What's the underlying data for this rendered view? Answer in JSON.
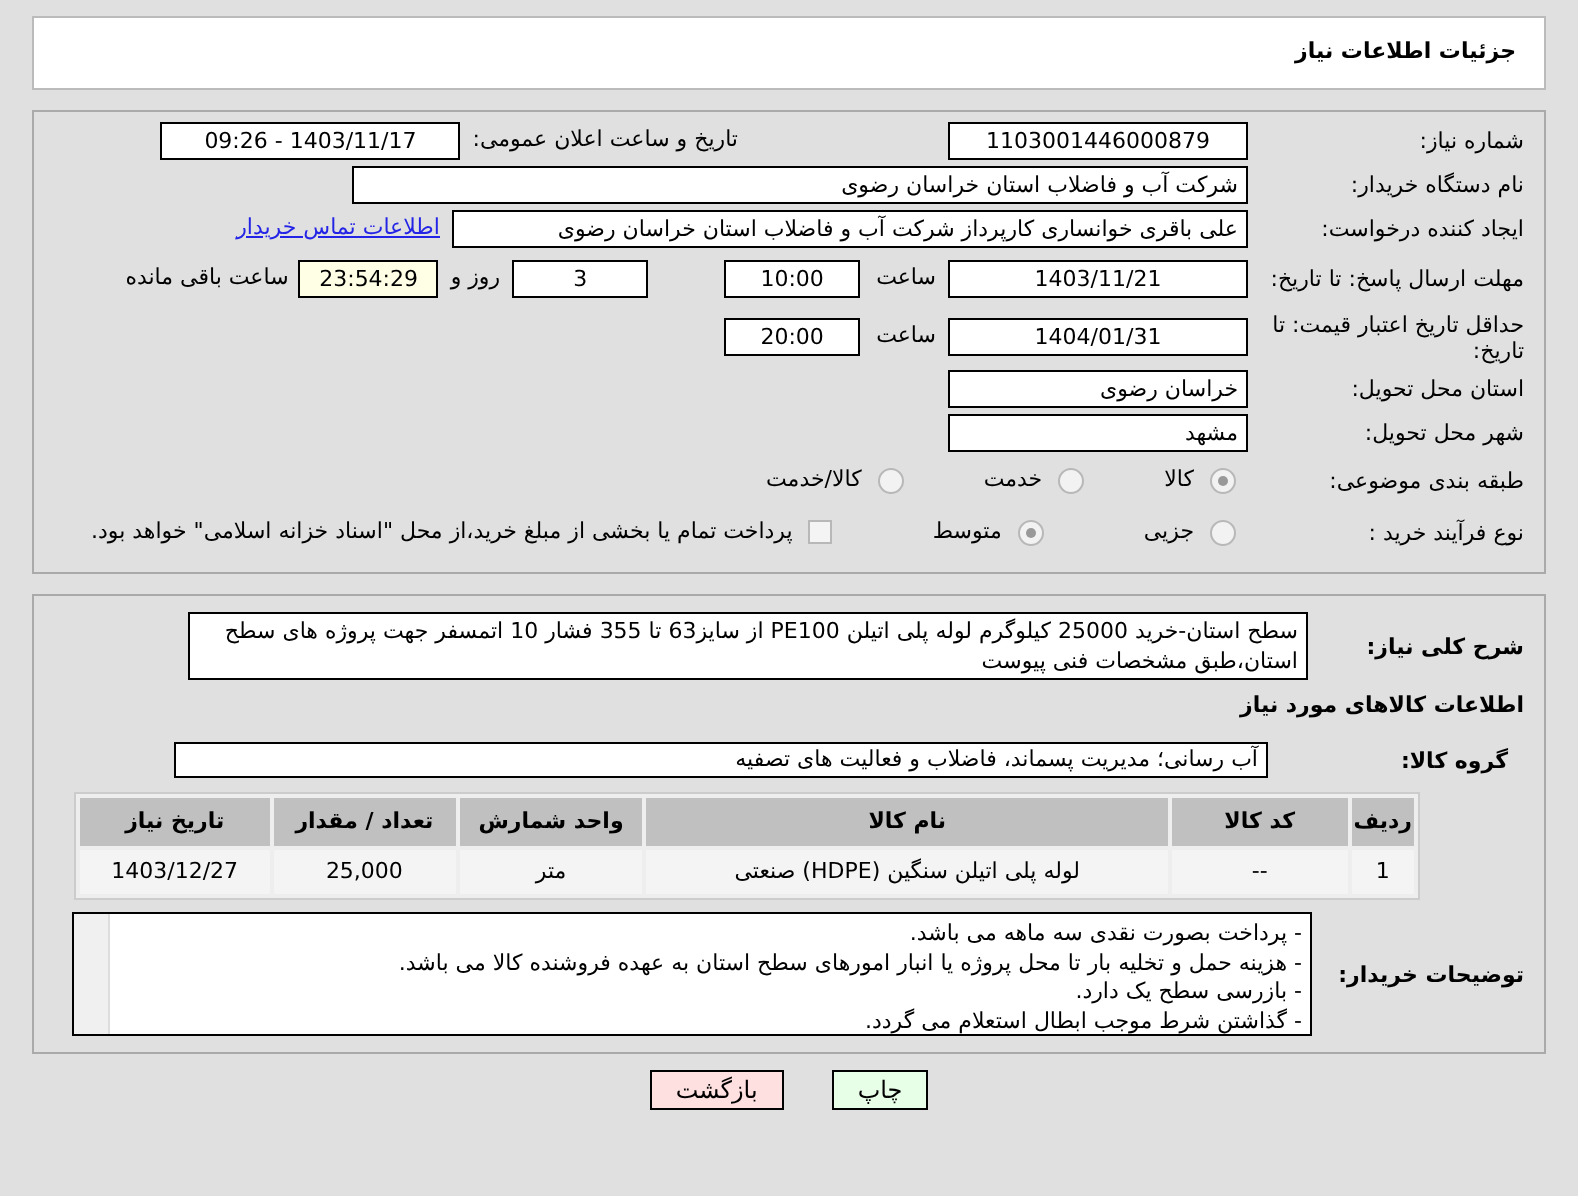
{
  "header": {
    "title": "جزئیات اطلاعات نیاز"
  },
  "need_number": {
    "label": "شماره نیاز:",
    "value": "1103001446000879"
  },
  "announce": {
    "label": "تاریخ و ساعت اعلان عمومی:",
    "value": "1403/11/17 - 09:26"
  },
  "buyer_org": {
    "label": "نام دستگاه خریدار:",
    "value": "شرکت آب و فاضلاب استان خراسان رضوی"
  },
  "requester": {
    "label": "ایجاد کننده درخواست:",
    "value": "علی باقری خوانساری کارپرداز شرکت آب و فاضلاب استان خراسان رضوی",
    "link": "اطلاعات تماس خریدار"
  },
  "deadline": {
    "label": "مهلت ارسال پاسخ: تا تاریخ:",
    "date": "1403/11/21",
    "time_label": "ساعت",
    "time": "10:00",
    "days": "3",
    "days_label": "روز و",
    "remaining": "23:54:29",
    "remaining_label": "ساعت باقی مانده"
  },
  "validity": {
    "label": "حداقل تاریخ اعتبار قیمت: تا تاریخ:",
    "date": "1404/01/31",
    "time_label": "ساعت",
    "time": "20:00"
  },
  "province": {
    "label": "استان محل تحویل:",
    "value": "خراسان رضوی"
  },
  "city": {
    "label": "شهر محل تحویل:",
    "value": "مشهد"
  },
  "category": {
    "label": "طبقه بندی موضوعی:",
    "options": [
      {
        "label": "کالا",
        "selected": true
      },
      {
        "label": "خدمت",
        "selected": false
      },
      {
        "label": "کالا/خدمت",
        "selected": false
      }
    ]
  },
  "process": {
    "label": "نوع فرآیند خرید :",
    "options": [
      {
        "label": "جزیی",
        "selected": false
      },
      {
        "label": "متوسط",
        "selected": true
      }
    ],
    "treasury": {
      "label": "پرداخت تمام یا بخشی از مبلغ خرید،از محل \"اسناد خزانه اسلامی\" خواهد بود.",
      "checked": false
    }
  },
  "description": {
    "label": "شرح کلی نیاز:",
    "value": "سطح استان-خرید 25000 کیلوگرم لوله پلی اتیلن PE100 از سایز63 تا 355 فشار 10 اتمسفر جهت پروژه های سطح استان،طبق مشخصات فنی پیوست"
  },
  "goods_title": "اطلاعات کالاهای مورد نیاز",
  "goods_group": {
    "label": "گروه کالا:",
    "value": "آب رسانی؛ مدیریت پسماند، فاضلاب و فعالیت های تصفیه"
  },
  "table": {
    "columns": [
      "ردیف",
      "کد کالا",
      "نام کالا",
      "واحد شمارش",
      "تعداد / مقدار",
      "تاریخ نیاز"
    ],
    "rows": [
      [
        "1",
        "--",
        "لوله پلی اتیلن سنگین (HDPE) صنعتی",
        "متر",
        "25,000",
        "1403/12/27"
      ]
    ]
  },
  "buyer_notes": {
    "label": "توضیحات خریدار:",
    "lines": [
      "- پرداخت بصورت نقدی سه ماهه می باشد.",
      "- هزینه حمل و تخلیه بار تا محل پروژه یا انبار امورهای سطح استان به عهده فروشنده کالا می باشد.",
      "-  بازرسی سطح یک دارد.",
      "- گذاشتن شرط موجب ابطال استعلام می گردد."
    ]
  },
  "buttons": [
    {
      "label": "چاپ",
      "kind": "print"
    },
    {
      "label": "بازگشت",
      "kind": "back"
    }
  ]
}
